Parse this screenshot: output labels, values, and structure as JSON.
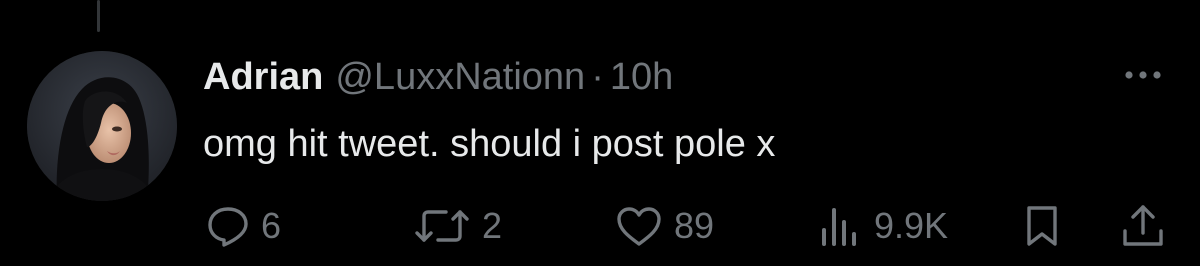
{
  "tweet": {
    "display_name": "Adrian",
    "handle": "@LuxxNationn",
    "separator": "·",
    "time": "10h",
    "text": "omg hit tweet. should i post pole x"
  },
  "metrics": {
    "replies": "6",
    "reposts": "2",
    "likes": "89",
    "views": "9.9K"
  },
  "icons": {
    "reply": "reply-icon",
    "repost": "repost-icon",
    "like": "heart-icon",
    "views": "views-icon",
    "bookmark": "bookmark-icon",
    "share": "share-icon",
    "more": "more-icon"
  },
  "colors": {
    "background": "#000000",
    "primary_text": "#e7e9ea",
    "secondary_text": "#71767b",
    "thread_line": "#333639"
  }
}
